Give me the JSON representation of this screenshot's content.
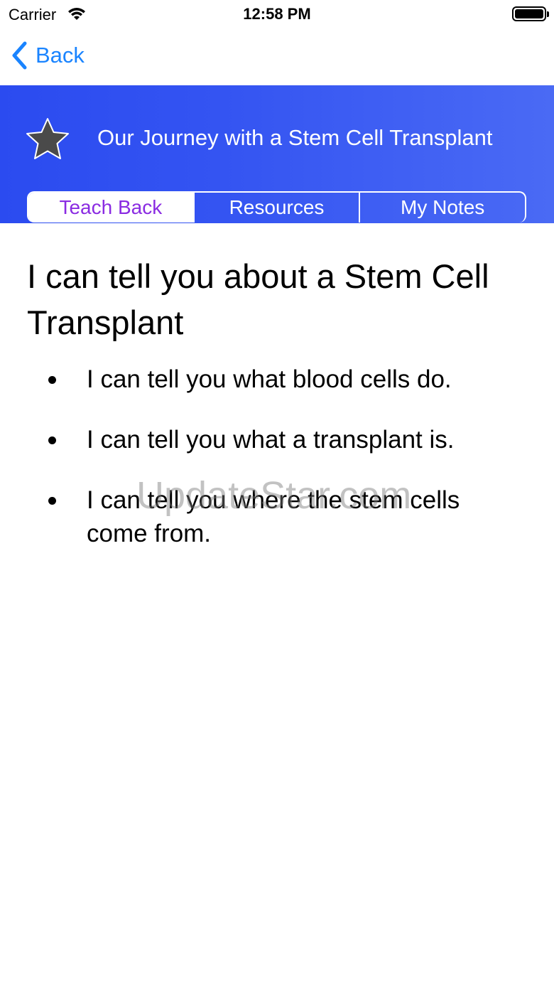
{
  "status_bar": {
    "carrier": "Carrier",
    "time": "12:58 PM"
  },
  "nav": {
    "back_label": "Back"
  },
  "banner": {
    "title": "Our Journey with a Stem Cell Transplant",
    "icon": "star-icon"
  },
  "tabs": [
    {
      "label": "Teach Back",
      "selected": true
    },
    {
      "label": "Resources",
      "selected": false
    },
    {
      "label": "My Notes",
      "selected": false
    }
  ],
  "content": {
    "heading": "I can tell you about a Stem Cell Transplant",
    "bullets": [
      "I can tell you what blood cells do.",
      "I can tell you what a transplant is.",
      "I can tell you where the stem cells come from."
    ]
  },
  "watermark": "UpdateStar.com",
  "colors": {
    "accent": "#1a84ff",
    "banner": "#3454f2",
    "selected_tab_text": "#8a2be2"
  }
}
